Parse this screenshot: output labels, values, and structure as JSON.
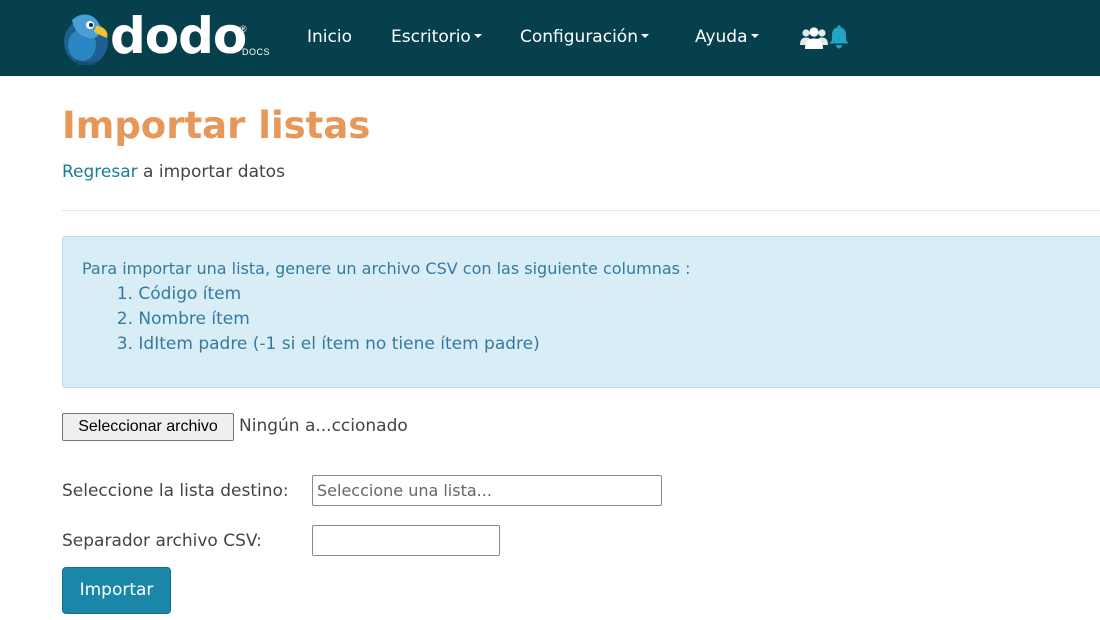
{
  "brand": {
    "name": "dodo",
    "sub": "DOCS",
    "reg": "®"
  },
  "nav": {
    "items": [
      {
        "label": "Inicio"
      },
      {
        "label": "Escritorio"
      },
      {
        "label": "Configuración"
      },
      {
        "label": "Ayuda"
      }
    ],
    "icons": [
      "users-icon",
      "bell-icon"
    ]
  },
  "page": {
    "title": "Importar listas",
    "back_link": "Regresar",
    "back_rest": " a importar datos"
  },
  "info": {
    "text": "Para importar una lista, genere un archivo CSV con las siguiente columnas :",
    "columns": [
      {
        "num": "1.",
        "label": "Código ítem"
      },
      {
        "num": "2.",
        "label": "Nombre ítem"
      },
      {
        "num": "3.",
        "label": "IdItem padre (-1 si el ítem no tiene ítem padre)"
      }
    ]
  },
  "file": {
    "button": "Seleccionar archivo",
    "status": "Ningún a...ccionado"
  },
  "form": {
    "list_label": "Seleccione la lista destino:",
    "list_placeholder": "Seleccione una lista...",
    "separator_label": "Separador archivo CSV:",
    "separator_value": ""
  },
  "actions": {
    "import": "Importar"
  },
  "colors": {
    "navbar": "#05404c",
    "title": "#e8975b",
    "link": "#177e97",
    "info_bg": "#d9edf6",
    "info_text": "#347aa0",
    "primary_button": "#1a87a8"
  }
}
